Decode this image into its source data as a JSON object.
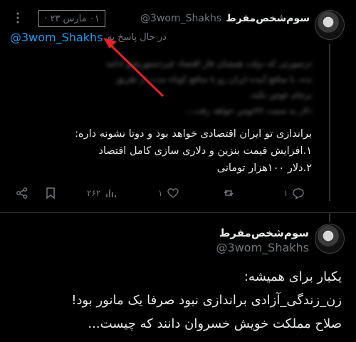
{
  "tweet1": {
    "display_name": "سوم‌شخص‌مفرط",
    "handle": "@3wom_Shakhs",
    "dot": "·",
    "date": "۰۱ مارس ۲۳",
    "reply_label": "در حال پاسخ به",
    "reply_to": "@3wom_Shakhs",
    "blurred_lines": [
      "درصورتی که دولت همچنان فاز اقتصاد غیردستوریشو ادامه",
      "بده، با منافع آینده ایران رو با منافع کوتاه مدت از طریق",
      "برجام عوض نکنه،",
      "دلار به سمت ۷۷تومن خواهد رفت..."
    ],
    "body_lines": [
      "براندازی تو ایران اقتصادی خواهد بود و دوتا نشونه داره:",
      "۱.افزایش قیمت بنزین و دلاری سازی کامل اقتصاد",
      "۲.دلار ۱۰۰هزار تومانی"
    ],
    "actions": {
      "replies": "۱",
      "retweets": "",
      "likes": "۱",
      "views": "۲۶۲"
    }
  },
  "tweet2": {
    "display_name": "سوم‌شخص‌مفرط",
    "handle": "@3wom_Shakhs",
    "body_lines": [
      "یکبار برای همیشه:",
      "زن_زندگی_آزادی براندازی نبود صرفا یک مانور بود!",
      "صلاح مملکت خویش خسروان دانند که چیست..."
    ]
  },
  "colors": {
    "background": "#000000",
    "text": "#e7e9ea",
    "muted": "#71767b",
    "link": "#1d9bf0",
    "annotation_arrow": "#e8202a"
  },
  "icons": {
    "more": "more-vertical-icon",
    "share": "share-icon",
    "bookmark": "bookmark-icon",
    "views": "views-chart-icon",
    "like": "heart-icon",
    "retweet": "retweet-icon",
    "reply": "reply-icon"
  }
}
